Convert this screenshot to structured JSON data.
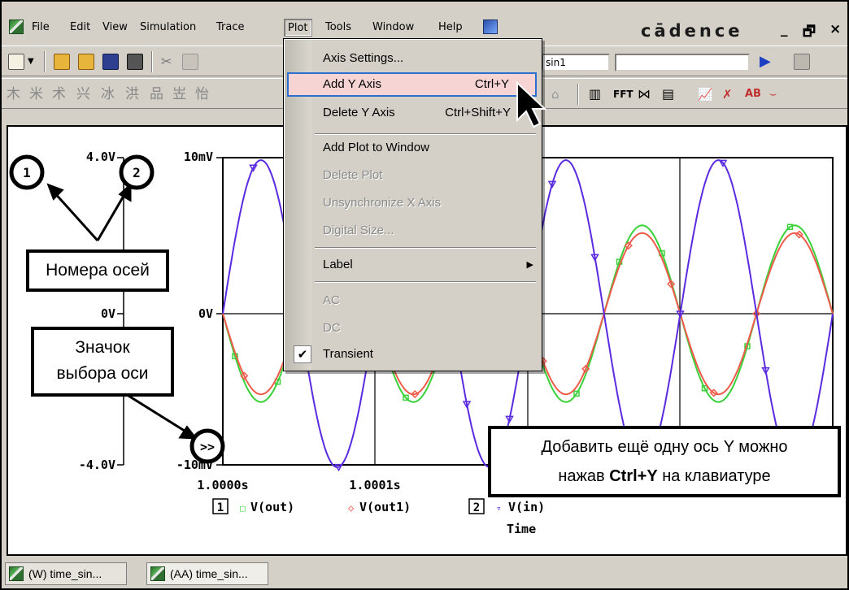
{
  "window": {
    "brand": "cādence",
    "controls": [
      "_",
      "🗗",
      "×"
    ]
  },
  "menubar": {
    "items": [
      "File",
      "Edit",
      "View",
      "Simulation",
      "Trace",
      "Plot",
      "Tools",
      "Window",
      "Help"
    ]
  },
  "toolbar": {
    "profile_field": "sin1",
    "search_field": ""
  },
  "plot_menu": {
    "items": [
      {
        "label": "Axis Settings...",
        "shortcut": "",
        "enabled": true
      },
      {
        "label": "Add Y Axis",
        "shortcut": "Ctrl+Y",
        "enabled": true,
        "highlighted": true
      },
      {
        "label": "Delete Y Axis",
        "shortcut": "Ctrl+Shift+Y",
        "enabled": true
      },
      {
        "label": "Add Plot to Window",
        "shortcut": "",
        "enabled": true
      },
      {
        "label": "Delete Plot",
        "shortcut": "",
        "enabled": false
      },
      {
        "label": "Unsynchronize X Axis",
        "shortcut": "",
        "enabled": false
      },
      {
        "label": "Digital Size...",
        "shortcut": "",
        "enabled": false
      },
      {
        "label": "Label",
        "shortcut": "",
        "enabled": true,
        "submenu": true
      },
      {
        "label": "AC",
        "shortcut": "",
        "enabled": false
      },
      {
        "label": "DC",
        "shortcut": "",
        "enabled": false
      },
      {
        "label": "Transient",
        "shortcut": "",
        "enabled": true,
        "checked": true
      }
    ]
  },
  "axes": {
    "axis1": {
      "top": "4.0V",
      "mid": "0V",
      "bottom": "-4.0V"
    },
    "axis2": {
      "top": "10mV",
      "mid": "0V",
      "bottom": "-10mV"
    },
    "x_ticks": [
      "1.0000s",
      "1.0001s"
    ],
    "x_label": "Time"
  },
  "legend": {
    "axis1_num": "1",
    "axis2_num": "2",
    "traces": [
      {
        "name": "V(out)",
        "marker": "□",
        "color": "#3ad13a"
      },
      {
        "name": "V(out1)",
        "marker": "◇",
        "color": "#f05a4a"
      },
      {
        "name": "V(in)",
        "marker": "▿",
        "color": "#5a2be0"
      }
    ]
  },
  "chart_data": {
    "type": "line",
    "title": "",
    "xlabel": "Time",
    "ylabel": "",
    "series": [
      {
        "name": "V(out)",
        "color": "#3ad13a",
        "axis": 1,
        "amplitude": 2.3,
        "phase_deg": 180
      },
      {
        "name": "V(out1)",
        "color": "#f05a4a",
        "axis": 1,
        "amplitude": 2.1,
        "phase_deg": 180
      },
      {
        "name": "V(in)",
        "color": "#5a2be0",
        "axis": 2,
        "amplitude": 10,
        "phase_deg": 0
      }
    ],
    "cycles_visible": 4
  },
  "annotations": {
    "axis_numbers_label": "Номера осей",
    "axis_select_label_1": "Значок",
    "axis_select_label_2": "выбора оси",
    "axis_select_icon": ">>",
    "circle1": "1",
    "circle2": "2",
    "hint_line1": "Добавить ещё одну ось Y можно",
    "hint_pre": "нажав ",
    "hint_key": "Ctrl+Y",
    "hint_post": " на клавиатуре"
  },
  "tabs": [
    {
      "label": "(W) time_sin..."
    },
    {
      "label": "(AA) time_sin..."
    }
  ]
}
